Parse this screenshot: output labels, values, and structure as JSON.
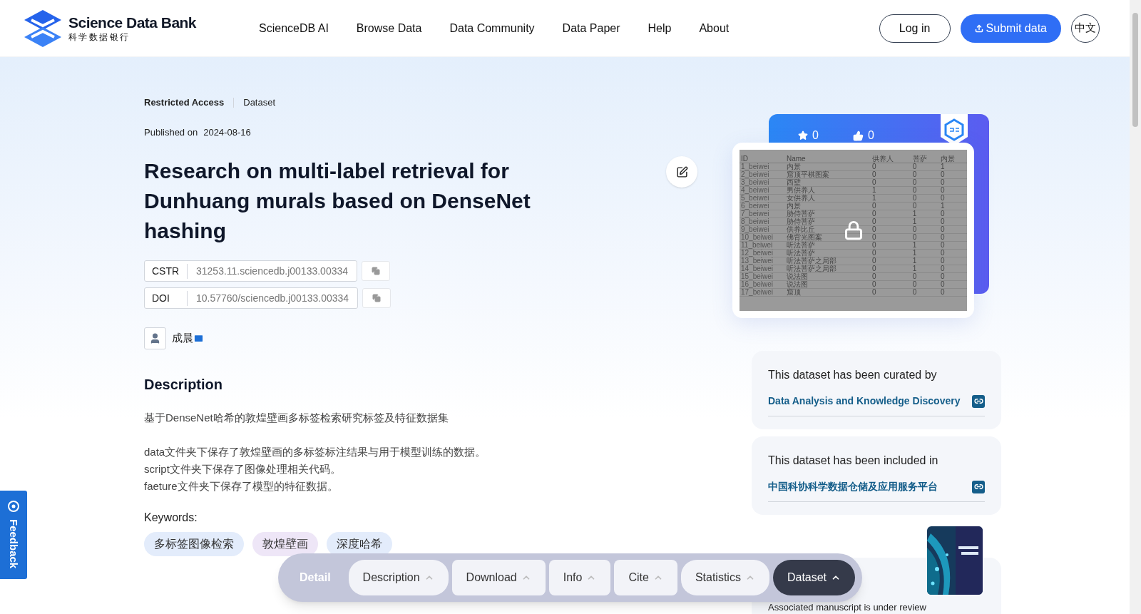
{
  "header": {
    "logo_title": "Science Data Bank",
    "logo_subtitle": "科学数据银行",
    "nav": [
      "ScienceDB AI",
      "Browse Data",
      "Data Community",
      "Data Paper",
      "Help",
      "About"
    ],
    "login": "Log in",
    "submit": "Submit data",
    "language": "中文"
  },
  "dataset": {
    "access": "Restricted Access",
    "type": "Dataset",
    "published_label": "Published on",
    "published_date": "2024-08-16",
    "title": "Research on multi-label retrieval for Dunhuang murals based on DenseNet hashing",
    "identifiers": [
      {
        "label": "CSTR",
        "value": "31253.11.sciencedb.j00133.00334"
      },
      {
        "label": "DOI",
        "value": "10.57760/sciencedb.j00133.00334"
      }
    ],
    "authors": [
      {
        "name": "成晨"
      }
    ],
    "description": {
      "heading": "Description",
      "paragraphs": [
        [
          "基于DenseNet哈希的敦煌壁画多标签检索研究标签及特征数据集"
        ],
        [
          "data文件夹下保存了敦煌壁画的多标签标注结果与用于模型训练的数据。",
          "script文件夹下保存了图像处理相关代码。",
          "faeture文件夹下保存了模型的特征数据。"
        ]
      ]
    },
    "keywords": {
      "label": "Keywords:",
      "items": [
        {
          "text": "多标签图像检索",
          "color": "#e3ecfb"
        },
        {
          "text": "敦煌壁画",
          "color": "#eee6f7"
        },
        {
          "text": "深度哈希",
          "color": "#e3ecfb"
        }
      ]
    }
  },
  "sidebar": {
    "stars": "0",
    "likes": "0",
    "preview": {
      "locked": true,
      "columns": [
        "ID",
        "Name",
        "供养人",
        "菩萨",
        "内景"
      ],
      "rows": [
        [
          "1_beiwei",
          "内景",
          "0",
          "0",
          "1"
        ],
        [
          "2_beiwei",
          "窟顶平棋图案",
          "0",
          "0",
          "0"
        ],
        [
          "3_beiwei",
          "西壁",
          "0",
          "0",
          "0"
        ],
        [
          "4_beiwei",
          "男供养人",
          "1",
          "0",
          "0"
        ],
        [
          "5_beiwei",
          "女供养人",
          "1",
          "0",
          "0"
        ],
        [
          "6_beiwei",
          "内景",
          "0",
          "0",
          "1"
        ],
        [
          "7_beiwei",
          "胁侍菩萨",
          "0",
          "1",
          "0"
        ],
        [
          "8_beiwei",
          "胁侍菩萨",
          "0",
          "1",
          "0"
        ],
        [
          "9_beiwei",
          "供养比丘",
          "0",
          "0",
          "0"
        ],
        [
          "10_beiwei",
          "佛背光图案",
          "0",
          "0",
          "0"
        ],
        [
          "11_beiwei",
          "听法菩萨",
          "0",
          "1",
          "0"
        ],
        [
          "12_beiwei",
          "听法菩萨",
          "0",
          "1",
          "0"
        ],
        [
          "13_beiwei",
          "听法菩萨之局部",
          "0",
          "1",
          "0"
        ],
        [
          "14_beiwei",
          "听法菩萨之局部",
          "0",
          "1",
          "0"
        ],
        [
          "15_beiwei",
          "说法图",
          "0",
          "0",
          "0"
        ],
        [
          "16_beiwei",
          "说法图",
          "0",
          "0",
          "0"
        ],
        [
          "17_beiwei",
          "窟顶",
          "0",
          "0",
          "0"
        ]
      ]
    },
    "curated": {
      "text": "This dataset has been curated by",
      "link": "Data Analysis and Knowledge Discovery"
    },
    "included": {
      "text": "This dataset has been included in",
      "link": "中国科协科学数据仓储及应用服务平台"
    },
    "manuscript": "Associated manuscript is under review"
  },
  "section_nav": {
    "label": "Detail",
    "tabs": [
      {
        "label": "Description",
        "selected": false
      },
      {
        "label": "Download",
        "selected": false
      },
      {
        "label": "Info",
        "selected": false
      },
      {
        "label": "Cite",
        "selected": false
      },
      {
        "label": "Statistics",
        "selected": false
      },
      {
        "label": "Dataset",
        "selected": true
      }
    ]
  },
  "feedback": "Feedback"
}
